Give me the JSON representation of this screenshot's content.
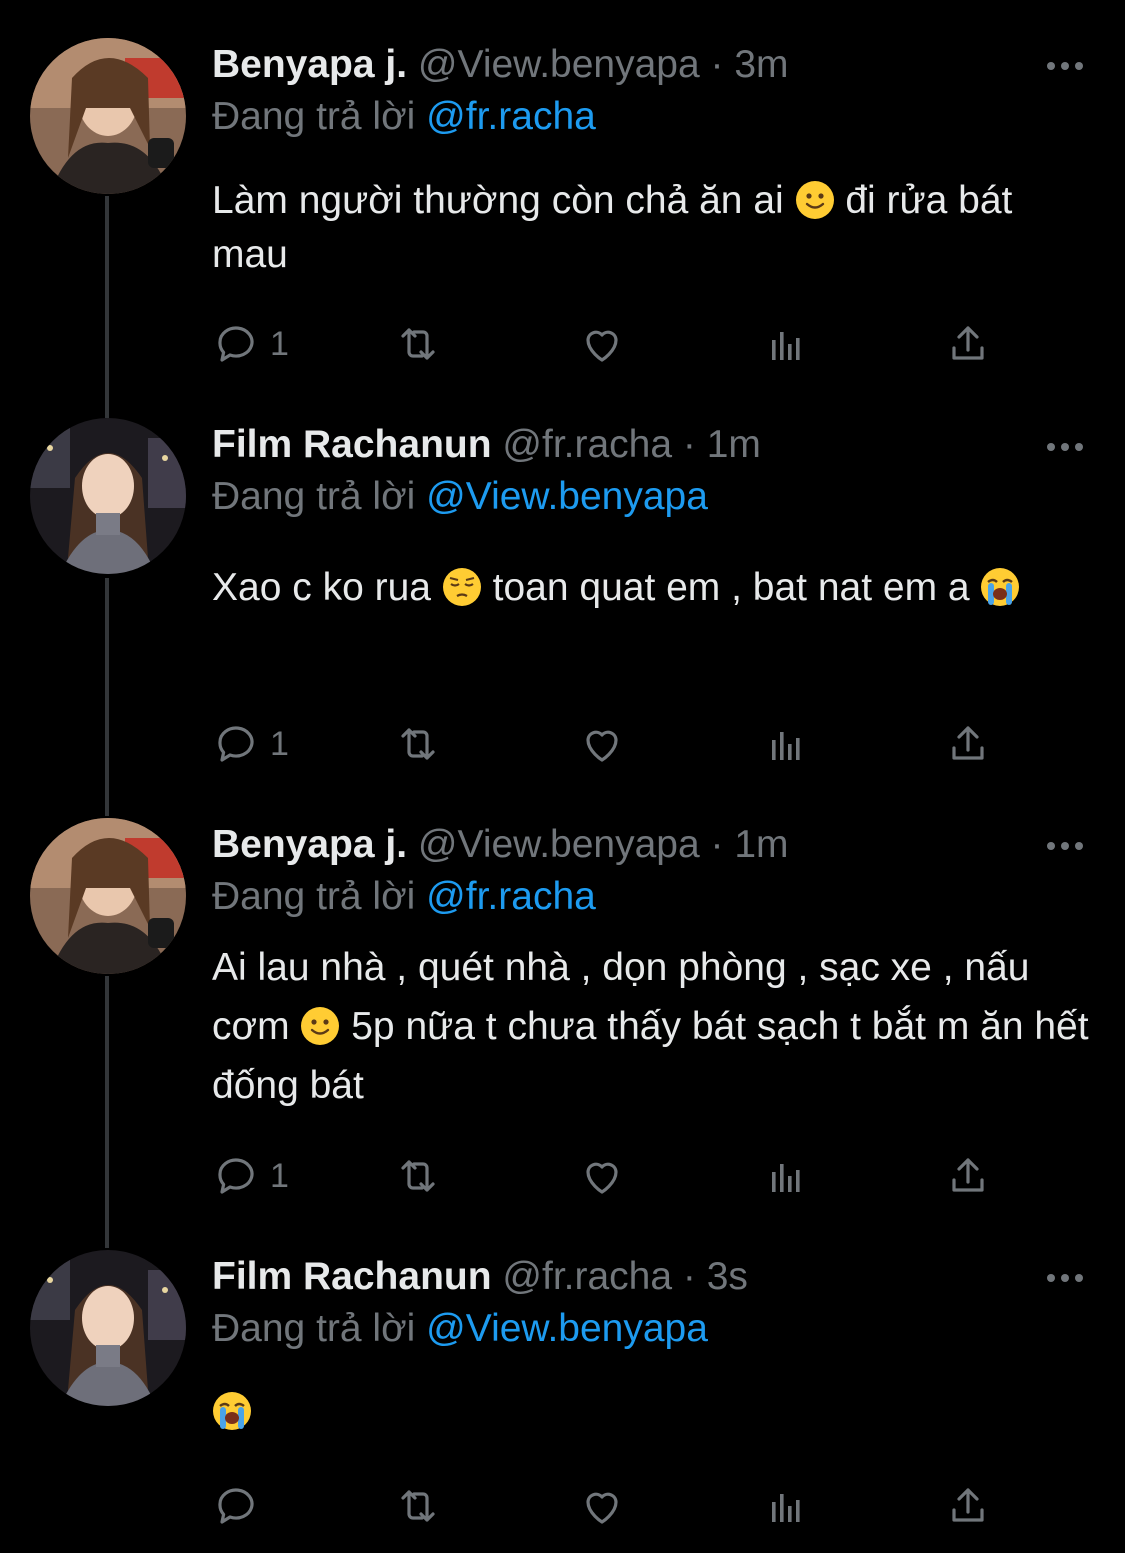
{
  "colors": {
    "background": "#000000",
    "text": "#e7e9ea",
    "secondary": "#71767b",
    "mention": "#1d9bf0",
    "thread_line": "#333639"
  },
  "tweets": [
    {
      "name": "Benyapa j.",
      "handle": "@View.benyapa",
      "dot": "·",
      "time": "3m",
      "replying_prefix": "Đang trả lời",
      "replying_to": "@fr.racha",
      "text_parts": [
        "Làm người thường còn chả ăn ai ",
        "  đi rửa bát mau"
      ],
      "emojis": [
        "slightly-smiling-face"
      ],
      "reply_count": "1",
      "icons": [
        "reply-icon",
        "retweet-icon",
        "like-icon",
        "views-icon",
        "share-icon",
        "more-icon"
      ]
    },
    {
      "name": "Film Rachanun",
      "handle": "@fr.racha",
      "dot": "·",
      "time": "1m",
      "replying_prefix": "Đang trả lời",
      "replying_to": "@View.benyapa",
      "text_parts": [
        "Xao c ko rua ",
        "  toan quat em , bat nat em a "
      ],
      "emojis": [
        "pensive-face",
        "loudly-crying-face"
      ],
      "reply_count": "1"
    },
    {
      "name": "Benyapa j.",
      "handle": "@View.benyapa",
      "dot": "·",
      "time": "1m",
      "replying_prefix": "Đang trả lời",
      "replying_to": "@fr.racha",
      "text_parts": [
        "Ai lau nhà , quét nhà , dọn phòng , sạc xe , nấu cơm ",
        "  5p nữa t chưa thấy bát sạch t bắt m ăn hết đống bát"
      ],
      "emojis": [
        "slightly-smiling-face"
      ],
      "reply_count": "1"
    },
    {
      "name": "Film Rachanun",
      "handle": "@fr.racha",
      "dot": "·",
      "time": "3s",
      "replying_prefix": "Đang trả lời",
      "replying_to": "@View.benyapa",
      "text_parts": [
        ""
      ],
      "emojis": [
        "loudly-crying-face"
      ],
      "reply_count": ""
    }
  ]
}
